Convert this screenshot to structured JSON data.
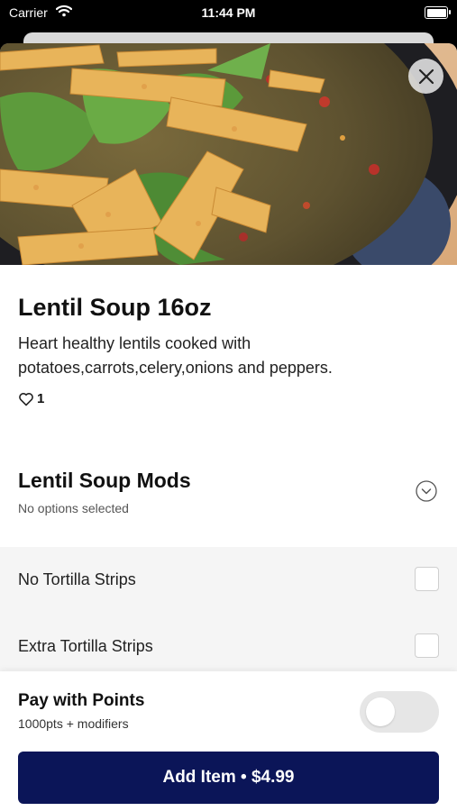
{
  "status_bar": {
    "carrier": "Carrier",
    "time": "11:44 PM"
  },
  "item": {
    "title": "Lentil Soup 16oz",
    "description": "Heart healthy lentils cooked with potatoes,carrots,celery,onions and peppers.",
    "likes": "1"
  },
  "mods": {
    "title": "Lentil Soup Mods",
    "subtitle": "No options selected",
    "options": [
      {
        "label": "No Tortilla Strips"
      },
      {
        "label": "Extra Tortilla Strips"
      }
    ]
  },
  "points": {
    "title": "Pay with Points",
    "subtitle": "1000pts + modifiers",
    "enabled": false
  },
  "add_button": {
    "label": "Add Item • $4.99"
  },
  "colors": {
    "primary": "#0b1558",
    "options_bg": "#f5f5f5",
    "toggle_off": "#e6e6e6"
  },
  "icons": [
    "wifi-icon",
    "battery-icon",
    "close-icon",
    "heart-icon",
    "chevron-down-circle-icon"
  ]
}
